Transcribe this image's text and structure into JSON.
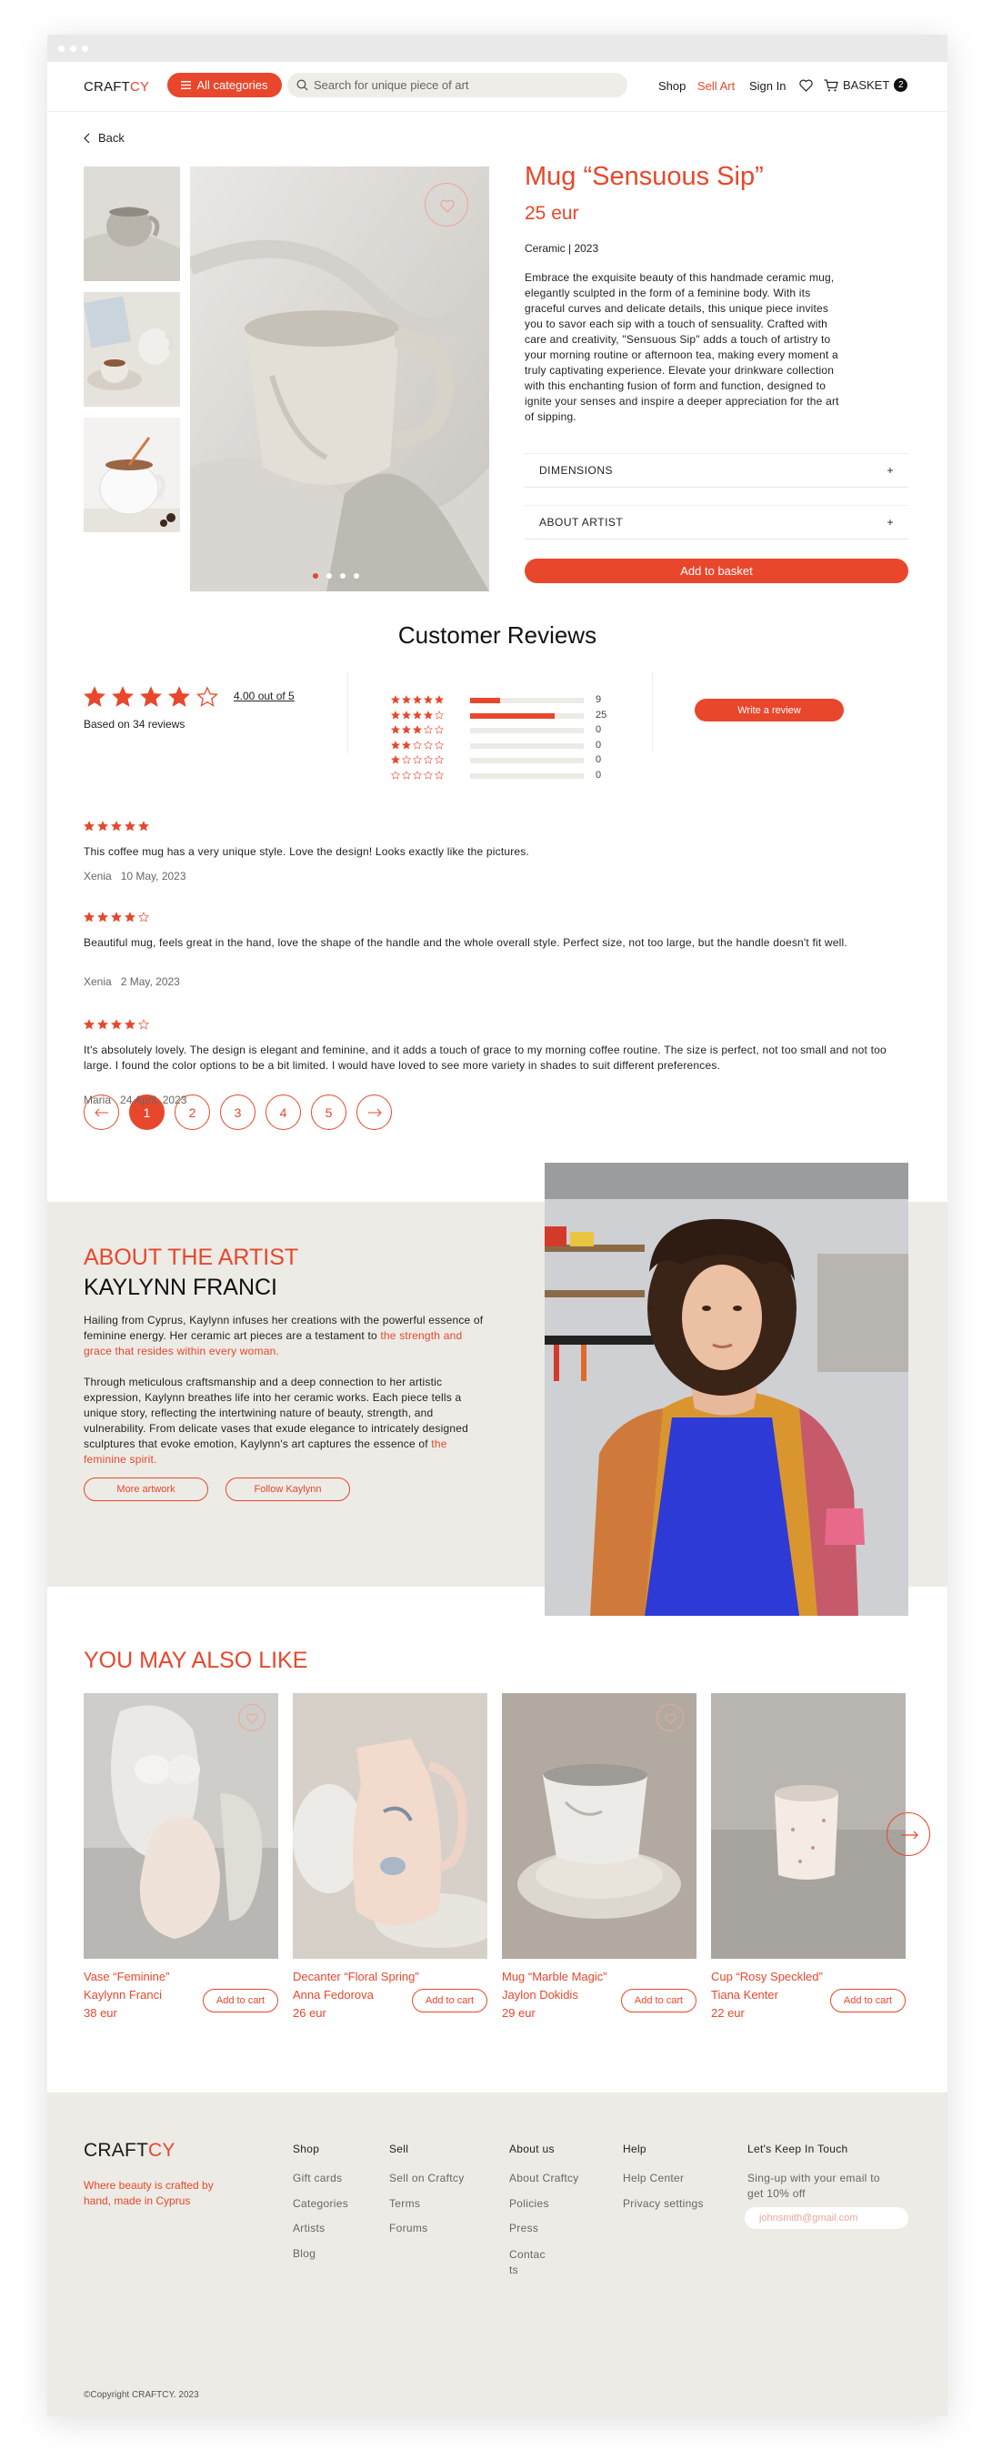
{
  "brand": {
    "logo_main": "CRAFT",
    "logo_accent": "CY",
    "accent": "#e8472c",
    "beige": "#edebe5"
  },
  "header": {
    "categories_label": "All categories",
    "search_placeholder": "Search for unique piece of art",
    "nav": [
      "Shop",
      "Sell Art",
      "Sign In"
    ],
    "basket_label": "BASKET",
    "basket_count": "2"
  },
  "back_label": "Back",
  "product": {
    "title": "Mug “Sensuous Sip”",
    "price": "25 eur",
    "meta": "Ceramic | 2023",
    "description": "Embrace the exquisite beauty of this handmade ceramic mug, elegantly sculpted in the form of a feminine body. With its graceful curves and delicate details, this unique piece invites you to savor each sip with a touch of sensuality. Crafted with care and creativity, \"Sensuous Sip\" adds a touch of artistry to your morning routine or afternoon tea, making every moment a truly captivating experience. Elevate your drinkware collection with this enchanting fusion of form and function, designed to ignite your senses and inspire a deeper appreciation for the art of sipping.",
    "accordion": [
      "DIMENSIONS",
      "ABOUT ARTIST"
    ],
    "accordion_icon": "+",
    "add_to_basket": "Add to basket",
    "image_count": 4,
    "active_image": 1
  },
  "reviews": {
    "heading": "Customer Reviews",
    "average_stars": 4,
    "average_text": "4.00 out of 5",
    "based_on": "Based on 34 reviews",
    "distribution": [
      {
        "stars": 5,
        "count": "9",
        "fraction": 0.26
      },
      {
        "stars": 4,
        "count": "25",
        "fraction": 0.74
      },
      {
        "stars": 3,
        "count": "0",
        "fraction": 0
      },
      {
        "stars": 2,
        "count": "0",
        "fraction": 0
      },
      {
        "stars": 1,
        "count": "0",
        "fraction": 0
      },
      {
        "stars": 0,
        "count": "0",
        "fraction": 0
      }
    ],
    "write_review": "Write a review",
    "items": [
      {
        "stars": 5,
        "text": "This coffee mug has a very unique style. Love the design! Looks exactly like the pictures.",
        "author": "Xenia",
        "date": "10 May, 2023"
      },
      {
        "stars": 4,
        "text": "Beautiful mug, feels great in the hand, love the shape of the handle and the whole overall style. Perfect size, not too large, but the handle doesn't fit well.",
        "author": "Xenia",
        "date": "2 May, 2023"
      },
      {
        "stars": 4,
        "text": "It's absolutely lovely. The design is elegant and feminine, and it adds a touch of grace to my morning coffee routine. The size is perfect, not too small and not too large. I found the color options to be a bit limited. I would have loved to see more variety in shades to suit different preferences.",
        "author": "Maria",
        "date": "24 April, 2023"
      }
    ],
    "pages": [
      "1",
      "2",
      "3",
      "4",
      "5"
    ],
    "current_page": "1"
  },
  "artist": {
    "eyebrow": "ABOUT THE ARTIST",
    "name": "KAYLYNN FRANCI",
    "p1_start": "Hailing from Cyprus, Kaylynn infuses her creations with the powerful essence of feminine energy. Her ceramic art pieces are a testament to ",
    "p1_highlight": "the strength and grace that resides within every woman.",
    "p2_start": "Through meticulous craftsmanship and a deep connection to her artistic expression, Kaylynn breathes life into her ceramic works. Each piece tells a unique story, reflecting the intertwining nature of beauty, strength, and vulnerability. From delicate vases that exude elegance to intricately designed sculptures that evoke emotion, Kaylynn's art captures the essence of ",
    "p2_highlight": "the feminine spirit.",
    "more_artwork": "More artwork",
    "follow": "Follow Kaylynn"
  },
  "also_like": {
    "heading": "YOU MAY ALSO LIKE",
    "add_label": "Add to cart",
    "items": [
      {
        "title": "Vase “Feminine”",
        "artist": "Kaylynn Franci",
        "price": "38 eur"
      },
      {
        "title": "Decanter “Floral Spring”",
        "artist": "Anna Fedorova",
        "price": "26 eur"
      },
      {
        "title": "Mug “Marble Magic”",
        "artist": "Jaylon Dokidis",
        "price": "29 eur"
      },
      {
        "title": "Cup “Rosy Speckled”",
        "artist": "Tiana Kenter",
        "price": "22 eur"
      }
    ]
  },
  "footer": {
    "tagline": "Where beauty is crafted by hand, made in Cyprus",
    "columns": [
      {
        "title": "Shop",
        "links": [
          "Gift cards",
          "Categories",
          "Artists",
          "Blog"
        ]
      },
      {
        "title": "Sell",
        "links": [
          "Sell on Craftcy",
          "Terms",
          "Forums"
        ]
      },
      {
        "title": "About us",
        "links": [
          "About Craftcy",
          "Policies",
          "Press",
          "Contacts"
        ]
      },
      {
        "title": "Help",
        "links": [
          "Help Center",
          "Privacy settings"
        ]
      }
    ],
    "newsletter_title": "Let's Keep In Touch",
    "newsletter_text": "Sing-up with your email to get 10% off",
    "email_placeholder": "johnsmith@gmail.com",
    "copyright": "©Copyright CRAFTCY. 2023"
  }
}
